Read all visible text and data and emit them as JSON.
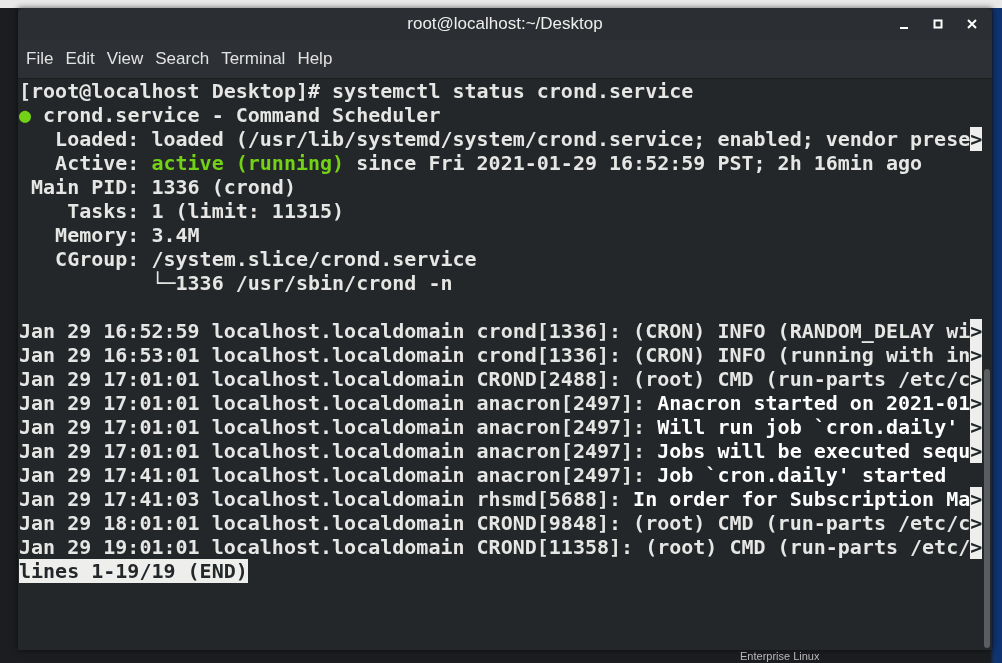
{
  "window": {
    "title": "root@localhost:~/Desktop"
  },
  "menu": [
    "File",
    "Edit",
    "View",
    "Search",
    "Terminal",
    "Help"
  ],
  "terminal": {
    "lines": [
      {
        "kind": "text",
        "segments": [
          {
            "kind": "normal",
            "text": "[root@localhost Desktop]# systemctl status crond.service"
          }
        ]
      },
      {
        "kind": "text",
        "segments": [
          {
            "kind": "green",
            "text": "●"
          },
          {
            "kind": "normal",
            "text": " crond.service - Command Scheduler"
          }
        ]
      },
      {
        "kind": "text",
        "segments": [
          {
            "kind": "normal",
            "text": "   Loaded: loaded (/usr/lib/systemd/system/crond.service; enabled; vendor prese"
          }
        ],
        "overflow_mark": ">"
      },
      {
        "kind": "text",
        "segments": [
          {
            "kind": "normal",
            "text": "   Active: "
          },
          {
            "kind": "green",
            "text": "active (running)"
          },
          {
            "kind": "normal",
            "text": " since Fri 2021-01-29 16:52:59 PST; 2h 16min ago"
          }
        ]
      },
      {
        "kind": "text",
        "segments": [
          {
            "kind": "normal",
            "text": " Main PID: 1336 (crond)"
          }
        ]
      },
      {
        "kind": "text",
        "segments": [
          {
            "kind": "normal",
            "text": "    Tasks: 1 (limit: 11315)"
          }
        ]
      },
      {
        "kind": "text",
        "segments": [
          {
            "kind": "normal",
            "text": "   Memory: 3.4M"
          }
        ]
      },
      {
        "kind": "text",
        "segments": [
          {
            "kind": "normal",
            "text": "   CGroup: /system.slice/crond.service"
          }
        ]
      },
      {
        "kind": "text",
        "segments": [
          {
            "kind": "normal",
            "text": "           └─1336 /usr/sbin/crond -n"
          }
        ]
      },
      {
        "kind": "blank"
      },
      {
        "kind": "text",
        "segments": [
          {
            "kind": "normal",
            "text": "Jan 29 16:52:59 localhost.localdomain crond[1336]: (CRON) INFO (RANDOM_DELAY wi"
          }
        ],
        "overflow_mark": ">"
      },
      {
        "kind": "text",
        "segments": [
          {
            "kind": "normal",
            "text": "Jan 29 16:53:01 localhost.localdomain crond[1336]: (CRON) INFO (running with in"
          }
        ],
        "overflow_mark": ">"
      },
      {
        "kind": "text",
        "segments": [
          {
            "kind": "normal",
            "text": "Jan 29 17:01:01 localhost.localdomain CROND[2488]: (root) CMD (run-parts /etc/c"
          }
        ],
        "overflow_mark": ">"
      },
      {
        "kind": "text",
        "segments": [
          {
            "kind": "normal",
            "text": "Jan 29 17:01:01 localhost.localdomain anacron[2497]: "
          },
          {
            "kind": "bright",
            "text": "Anacron started on 2021-01"
          }
        ],
        "overflow_mark": ">"
      },
      {
        "kind": "text",
        "segments": [
          {
            "kind": "normal",
            "text": "Jan 29 17:01:01 localhost.localdomain anacron[2497]: "
          },
          {
            "kind": "bright",
            "text": "Will run job `cron.daily' "
          }
        ],
        "overflow_mark": ">"
      },
      {
        "kind": "text",
        "segments": [
          {
            "kind": "normal",
            "text": "Jan 29 17:01:01 localhost.localdomain anacron[2497]: "
          },
          {
            "kind": "bright",
            "text": "Jobs will be executed sequ"
          }
        ],
        "overflow_mark": ">"
      },
      {
        "kind": "text",
        "segments": [
          {
            "kind": "normal",
            "text": "Jan 29 17:41:01 localhost.localdomain anacron[2497]: "
          },
          {
            "kind": "bright",
            "text": "Job `cron.daily' started"
          }
        ]
      },
      {
        "kind": "text",
        "segments": [
          {
            "kind": "normal",
            "text": "Jan 29 17:41:03 localhost.localdomain rhsmd[5688]: "
          },
          {
            "kind": "bright",
            "text": "In order for Subscription Ma"
          }
        ],
        "overflow_mark": ">"
      },
      {
        "kind": "text",
        "segments": [
          {
            "kind": "normal",
            "text": "Jan 29 18:01:01 localhost.localdomain CROND[9848]: (root) CMD (run-parts /etc/c"
          }
        ],
        "overflow_mark": ">"
      },
      {
        "kind": "text",
        "segments": [
          {
            "kind": "normal",
            "text": "Jan 29 19:01:01 localhost.localdomain CROND[11358]: (root) CMD (run-parts /etc/"
          }
        ],
        "overflow_mark": ">"
      },
      {
        "kind": "status",
        "segments": [
          {
            "kind": "normal",
            "text": "lines 1-19/19 (END)"
          }
        ]
      }
    ]
  },
  "desktop": {
    "text": "Enterprise Linux"
  }
}
